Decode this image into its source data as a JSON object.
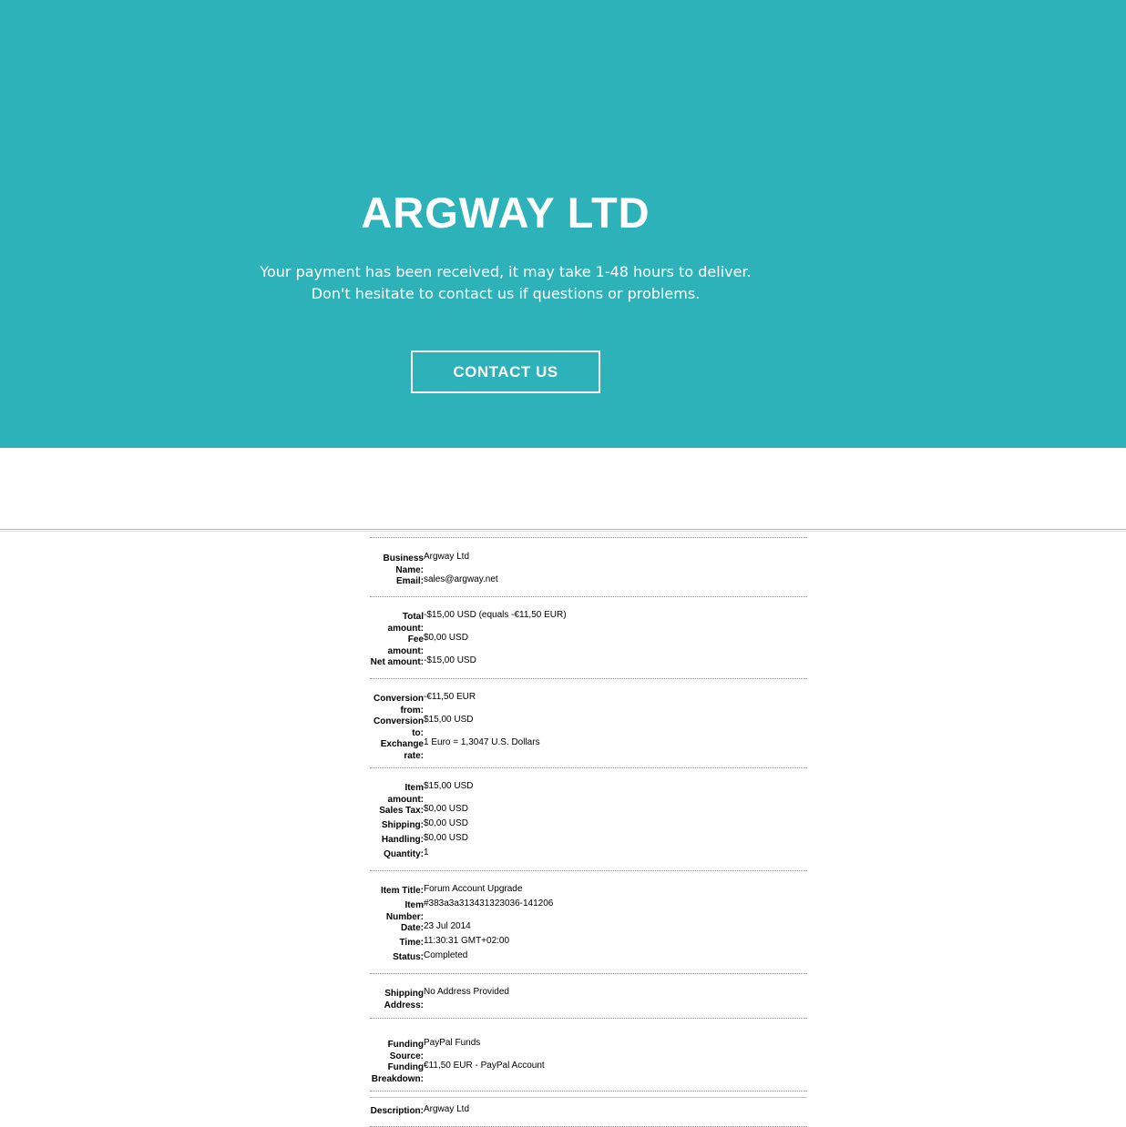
{
  "hero": {
    "title": "ARGWAY LTD",
    "line1": "Your payment has been received, it may take 1-48 hours to deliver.",
    "line2": "Don't hesitate to contact us if questions or problems.",
    "contact_label": "CONTACT US",
    "bg_color": "#2db2b9"
  },
  "details": {
    "groups": [
      {
        "rows": [
          {
            "label_lines": [
              "Business",
              "Name:"
            ],
            "value": "Argway Ltd"
          },
          {
            "label_lines": [
              "Email:"
            ],
            "value": "sales@argway.net"
          }
        ]
      },
      {
        "rows": [
          {
            "label_lines": [
              "Total",
              "amount:"
            ],
            "value": "-$15,00 USD (equals -€11,50 EUR)"
          },
          {
            "label_lines": [
              "Fee",
              "amount:"
            ],
            "value": "$0,00 USD"
          },
          {
            "label_lines": [
              "Net amount:"
            ],
            "value": "-$15,00 USD"
          }
        ]
      },
      {
        "rows": [
          {
            "label_lines": [
              "Conversion",
              "from:"
            ],
            "value": "-€11,50 EUR"
          },
          {
            "label_lines": [
              "Conversion",
              "to:"
            ],
            "value": "$15,00 USD"
          },
          {
            "label_lines": [
              "Exchange",
              "rate:"
            ],
            "value": "1 Euro = 1,3047 U.S. Dollars"
          }
        ]
      },
      {
        "rows": [
          {
            "label_lines": [
              "Item",
              "amount:"
            ],
            "value": "$15,00 USD"
          },
          {
            "label_lines": [
              "Sales Tax:"
            ],
            "value": "$0,00 USD"
          },
          {
            "label_lines": [
              "Shipping:"
            ],
            "value": "$0,00 USD"
          },
          {
            "label_lines": [
              "Handling:"
            ],
            "value": "$0,00 USD"
          },
          {
            "label_lines": [
              "Quantity:"
            ],
            "value": "1"
          }
        ]
      },
      {
        "rows": [
          {
            "label_lines": [
              "Item Title:"
            ],
            "value": "Forum Account Upgrade"
          },
          {
            "label_lines": [
              "Item",
              "Number:"
            ],
            "value": "#383a3a313431323036-141206"
          },
          {
            "label_lines": [
              "Date:"
            ],
            "value": "23 Jul 2014"
          },
          {
            "label_lines": [
              "Time:"
            ],
            "value": "11:30:31 GMT+02:00"
          },
          {
            "label_lines": [
              "Status:"
            ],
            "value": "Completed"
          }
        ]
      },
      {
        "rows": [
          {
            "label_lines": [
              "Shipping",
              "Address:"
            ],
            "value": "No Address Provided"
          }
        ]
      },
      {
        "rows": [
          {
            "label_lines": [
              "Funding",
              "Source:"
            ],
            "value": "PayPal Funds"
          },
          {
            "label_lines": [
              "Funding",
              "Breakdown:"
            ],
            "value": "€11,50 EUR - PayPal Account"
          }
        ]
      },
      {
        "rows": [
          {
            "label_lines": [
              "Description:"
            ],
            "value": "Argway Ltd"
          }
        ]
      }
    ]
  }
}
